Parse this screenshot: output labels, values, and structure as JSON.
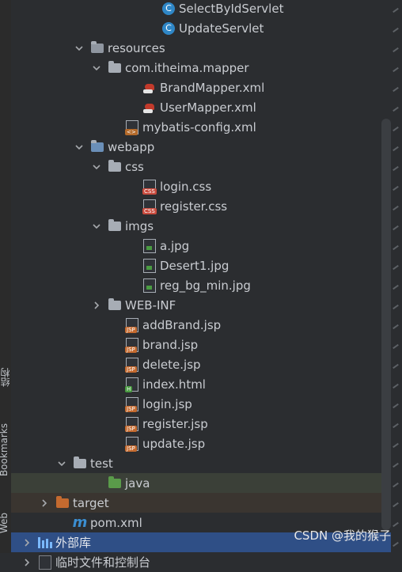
{
  "sidebar": {
    "structure_label": "结构",
    "bookmarks_label": "Bookmarks",
    "web_label": "Web"
  },
  "tree": [
    {
      "label": "SelectByIdServlet",
      "icon": "class-c-icon",
      "indent": 168,
      "arrow": "none"
    },
    {
      "label": "UpdateServlet",
      "icon": "class-c-icon",
      "indent": 168,
      "arrow": "none"
    },
    {
      "label": "resources",
      "icon": "resources-folder-icon",
      "indent": 78,
      "arrow": "down"
    },
    {
      "label": "com.itheima.mapper",
      "icon": "folder-icon",
      "indent": 100,
      "arrow": "down"
    },
    {
      "label": "BrandMapper.xml",
      "icon": "mybatis-icon",
      "indent": 144,
      "arrow": "none"
    },
    {
      "label": "UserMapper.xml",
      "icon": "mybatis-icon",
      "indent": 144,
      "arrow": "none"
    },
    {
      "label": "mybatis-config.xml",
      "icon": "xml-icon",
      "indent": 122,
      "arrow": "none"
    },
    {
      "label": "webapp",
      "icon": "webapp-folder-icon",
      "indent": 78,
      "arrow": "down"
    },
    {
      "label": "css",
      "icon": "folder-icon",
      "indent": 100,
      "arrow": "down"
    },
    {
      "label": "login.css",
      "icon": "css-file-icon",
      "indent": 144,
      "arrow": "none"
    },
    {
      "label": "register.css",
      "icon": "css-file-icon",
      "indent": 144,
      "arrow": "none"
    },
    {
      "label": "imgs",
      "icon": "folder-icon",
      "indent": 100,
      "arrow": "down"
    },
    {
      "label": "a.jpg",
      "icon": "image-file-icon",
      "indent": 144,
      "arrow": "none"
    },
    {
      "label": "Desert1.jpg",
      "icon": "image-file-icon",
      "indent": 144,
      "arrow": "none"
    },
    {
      "label": "reg_bg_min.jpg",
      "icon": "image-file-icon",
      "indent": 144,
      "arrow": "none"
    },
    {
      "label": "WEB-INF",
      "icon": "folder-icon",
      "indent": 100,
      "arrow": "right"
    },
    {
      "label": "addBrand.jsp",
      "icon": "jsp-file-icon",
      "indent": 122,
      "arrow": "none"
    },
    {
      "label": "brand.jsp",
      "icon": "jsp-file-icon",
      "indent": 122,
      "arrow": "none"
    },
    {
      "label": "delete.jsp",
      "icon": "jsp-file-icon",
      "indent": 122,
      "arrow": "none"
    },
    {
      "label": "index.html",
      "icon": "html-file-icon",
      "indent": 122,
      "arrow": "none"
    },
    {
      "label": "login.jsp",
      "icon": "jsp-file-icon",
      "indent": 122,
      "arrow": "none"
    },
    {
      "label": "register.jsp",
      "icon": "jsp-file-icon",
      "indent": 122,
      "arrow": "none"
    },
    {
      "label": "update.jsp",
      "icon": "jsp-file-icon",
      "indent": 122,
      "arrow": "none"
    },
    {
      "label": "test",
      "icon": "folder-icon",
      "indent": 56,
      "arrow": "down"
    },
    {
      "label": "java",
      "icon": "source-folder-icon",
      "indent": 100,
      "arrow": "none",
      "selected": "green"
    },
    {
      "label": "target",
      "icon": "target-folder-icon",
      "indent": 34,
      "arrow": "right",
      "selected": "orange"
    },
    {
      "label": "pom.xml",
      "icon": "maven-icon",
      "indent": 56,
      "arrow": "none"
    },
    {
      "label": "外部库",
      "icon": "library-icon",
      "indent": 12,
      "arrow": "right",
      "selected": "focus"
    },
    {
      "label": "临时文件和控制台",
      "icon": "scratch-icon",
      "indent": 12,
      "arrow": "right"
    }
  ],
  "watermark": "CSDN @我的猴子",
  "colors": {
    "background": "#2b2d30",
    "focus": "#2f4f86",
    "text": "#c9ccd1"
  }
}
